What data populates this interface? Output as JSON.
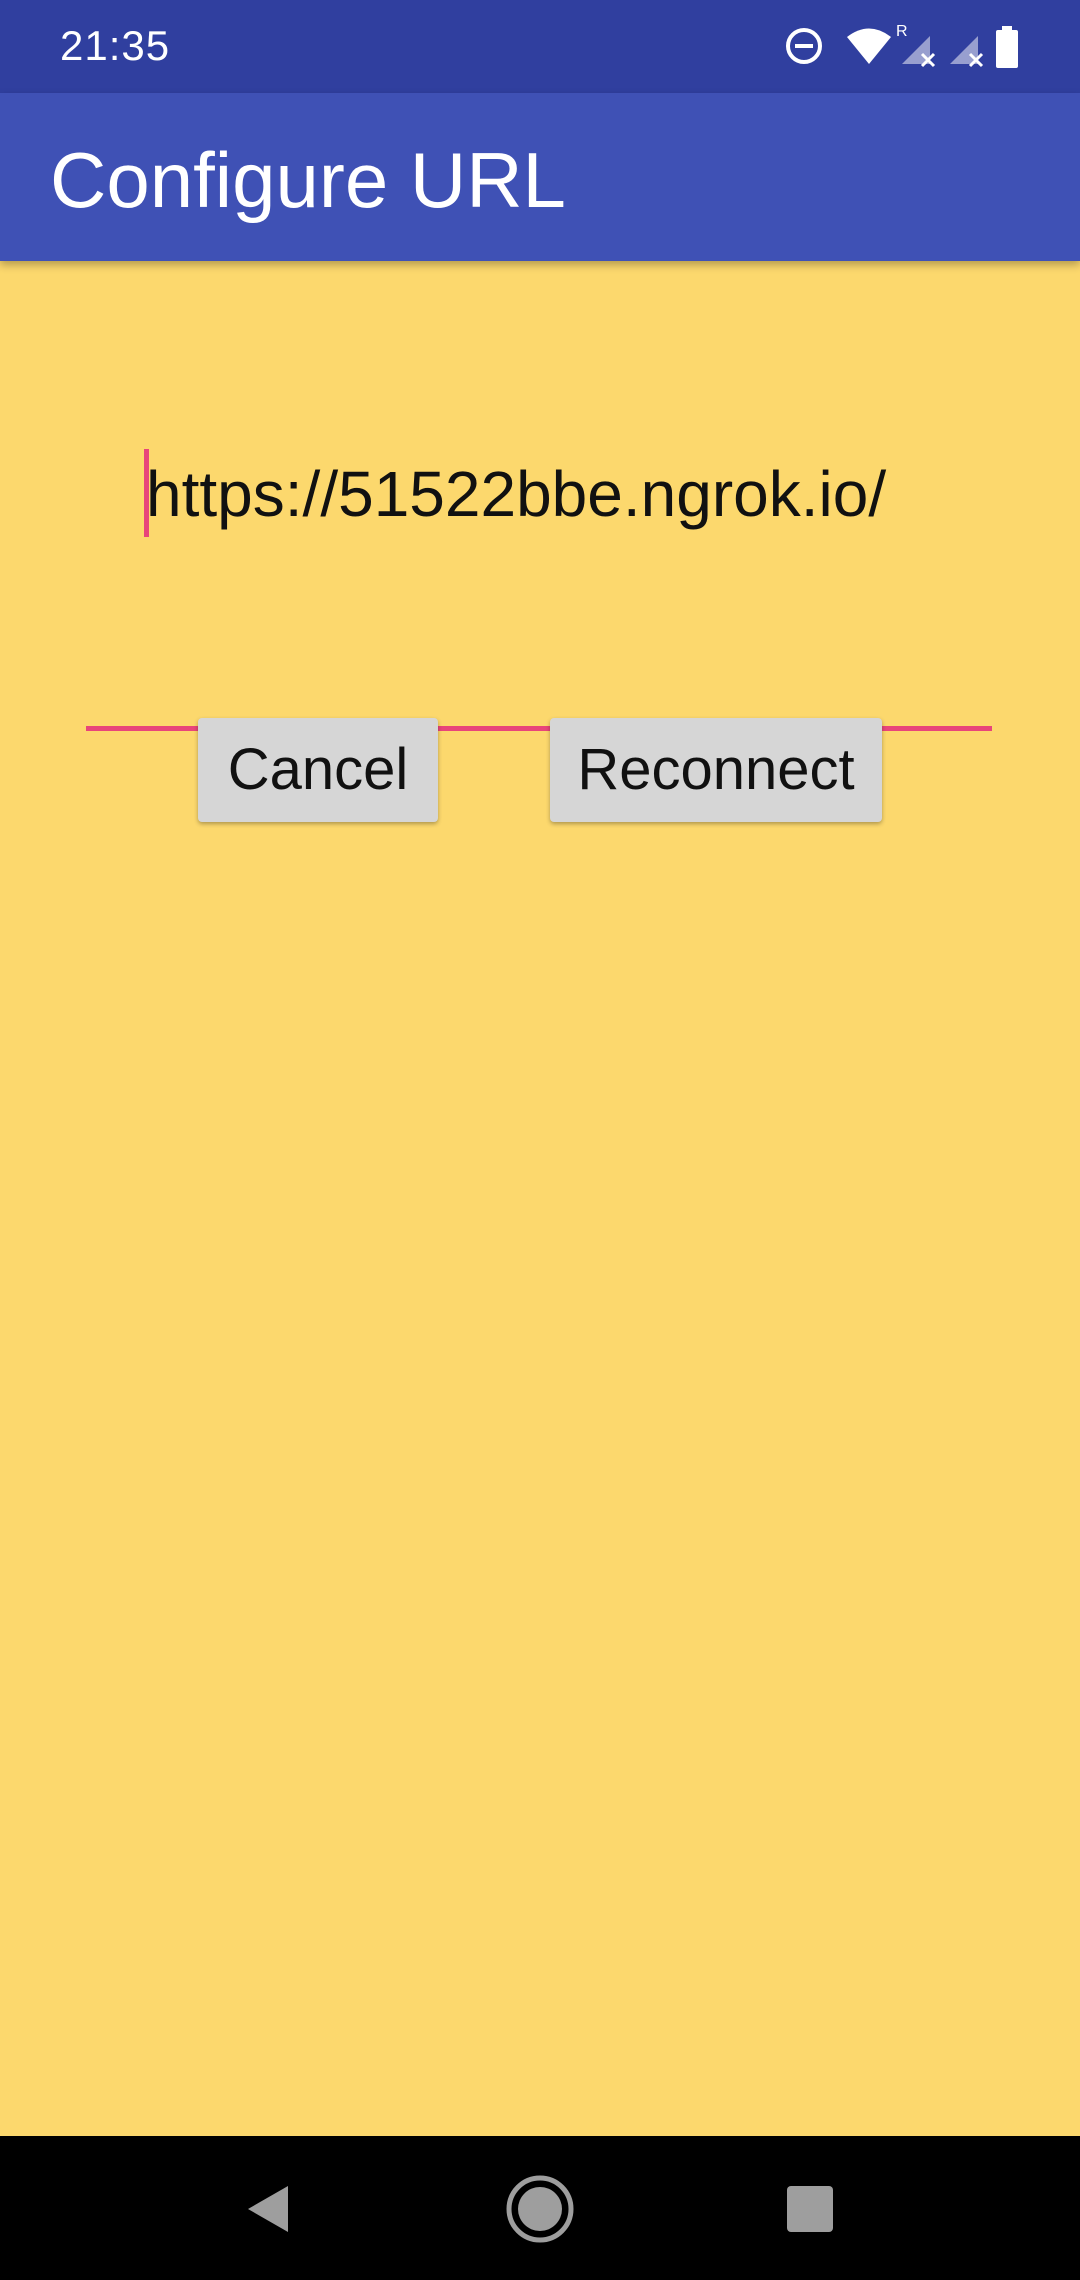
{
  "status_bar": {
    "time": "21:35",
    "icons": [
      "do-not-disturb-icon",
      "wifi-icon",
      "roaming-signal-icon",
      "signal-no-service-icon",
      "battery-icon"
    ],
    "roaming_indicator": "R"
  },
  "app_bar": {
    "title": "Configure URL",
    "color": "#3F51B5"
  },
  "form": {
    "url_value": "https://51522bbe.ngrok.io/",
    "accent_color": "#E8457A"
  },
  "buttons": {
    "cancel_label": "Cancel",
    "reconnect_label": "Reconnect"
  },
  "nav_bar": {
    "icons": [
      "back-icon",
      "home-icon",
      "recents-icon"
    ]
  },
  "theme": {
    "background": "#FCD86D",
    "status_bar": "#303F9F"
  }
}
